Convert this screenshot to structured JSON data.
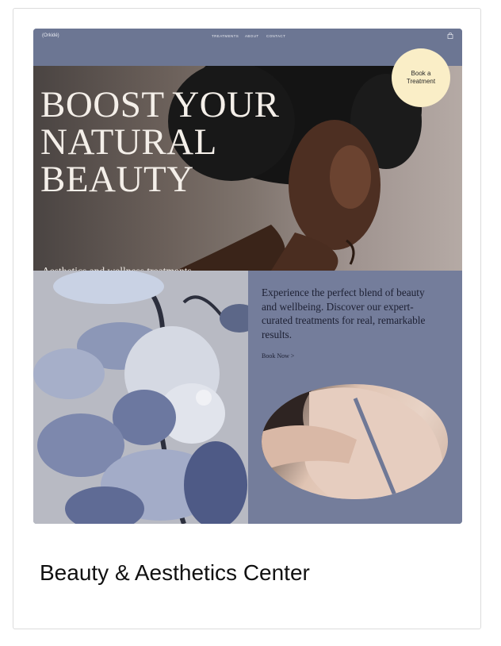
{
  "site": {
    "logo": "(Orkidé)",
    "nav": [
      "TREATMENTS",
      "ABOUT",
      "CONTACT"
    ],
    "hero_title_lines": [
      "BOOST YOUR",
      "NATURAL",
      "BEAUTY"
    ],
    "hero_subtitle": "Aesthetics and wellness treatments for every body",
    "book_bubble": "Book a Treatment",
    "blurb": "Experience the perfect blend of beauty and wellbeing. Discover our expert-curated treatments for real, remarkable results.",
    "book_now": "Book Now  >"
  },
  "card": {
    "title": "Beauty & Aesthetics Center"
  },
  "icons": {
    "cart": "shopping-bag-icon"
  },
  "colors": {
    "nav_bg": "#6c7693",
    "panel_bg": "#747d9b",
    "bubble": "#faeec7"
  }
}
